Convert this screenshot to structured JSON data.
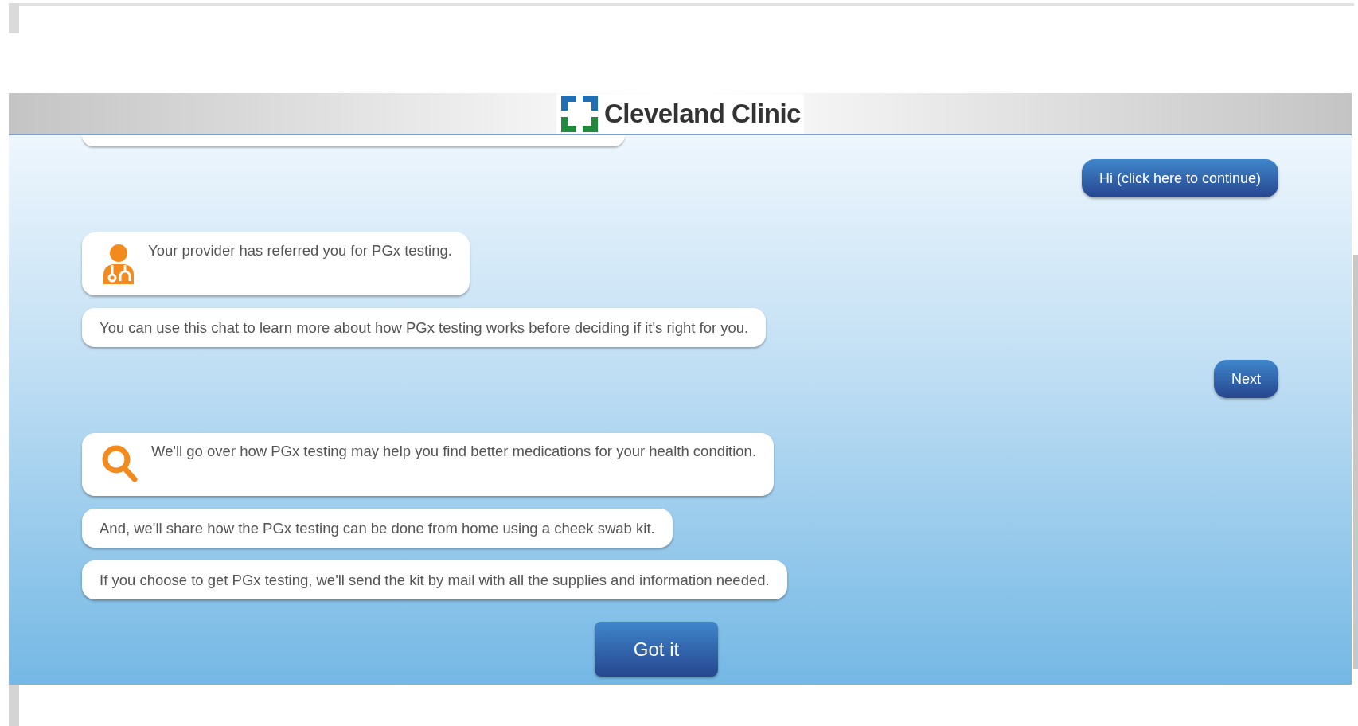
{
  "header": {
    "logo_text": "Cleveland Clinic"
  },
  "messages": [
    {
      "kind": "reply",
      "text": "Hi (click here to continue)"
    },
    {
      "kind": "message",
      "text": "Your provider has referred you for PGx testing."
    },
    {
      "kind": "message",
      "text": "You can use this chat to learn more about how PGx testing works before deciding if it's right for you."
    },
    {
      "kind": "reply",
      "text": "Next"
    },
    {
      "kind": "message",
      "text": "We'll go over how PGx testing may help you find better medications for your health condition."
    },
    {
      "kind": "message",
      "text": "And, we'll share how the PGx testing can be done from home using a cheek swab kit."
    },
    {
      "kind": "message",
      "text": "If you choose to get PGx testing, we'll send the kit by mail with all the supplies and information needed."
    }
  ],
  "action_button": "Got it"
}
